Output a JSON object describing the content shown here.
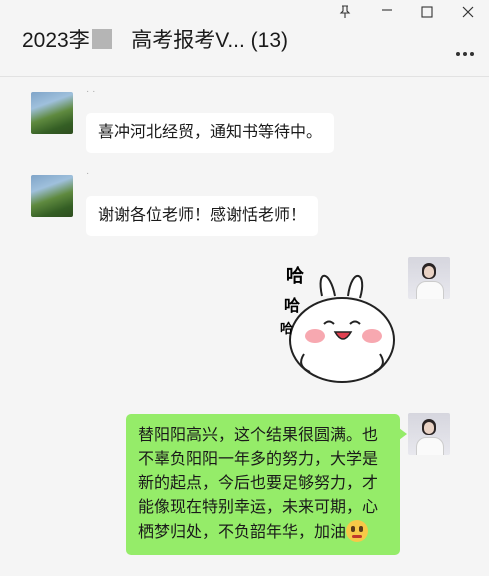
{
  "window": {
    "title_prefix": "2023李",
    "title_suffix": "高考报考V...",
    "member_count": "(13)",
    "pin_icon": "pin-icon",
    "minimize_icon": "minimize-icon",
    "maximize_icon": "maximize-icon",
    "close_icon": "close-icon",
    "more_icon": "more-dots-icon"
  },
  "messages": [
    {
      "side": "left",
      "sender": "· ·",
      "text": "喜冲河北经贸，通知书等待中。"
    },
    {
      "side": "left",
      "sender": "·",
      "text": "谢谢各位老师！感谢恬老师！"
    },
    {
      "side": "right",
      "type": "sticker",
      "sticker_text": [
        "哈",
        "哈",
        "哈"
      ]
    },
    {
      "side": "right",
      "type": "text",
      "text": "替阳阳高兴，这个结果很圆满。也不辜负阳阳一年多的努力，大学是新的起点，今后也要足够努力，才能像现在特别幸运，未来可期，心栖梦归处，不负韶年华，加油",
      "emoji": "smile-emoji"
    }
  ],
  "colors": {
    "background": "#f5f5f5",
    "self_bubble": "#95ec69",
    "other_bubble": "#ffffff"
  }
}
